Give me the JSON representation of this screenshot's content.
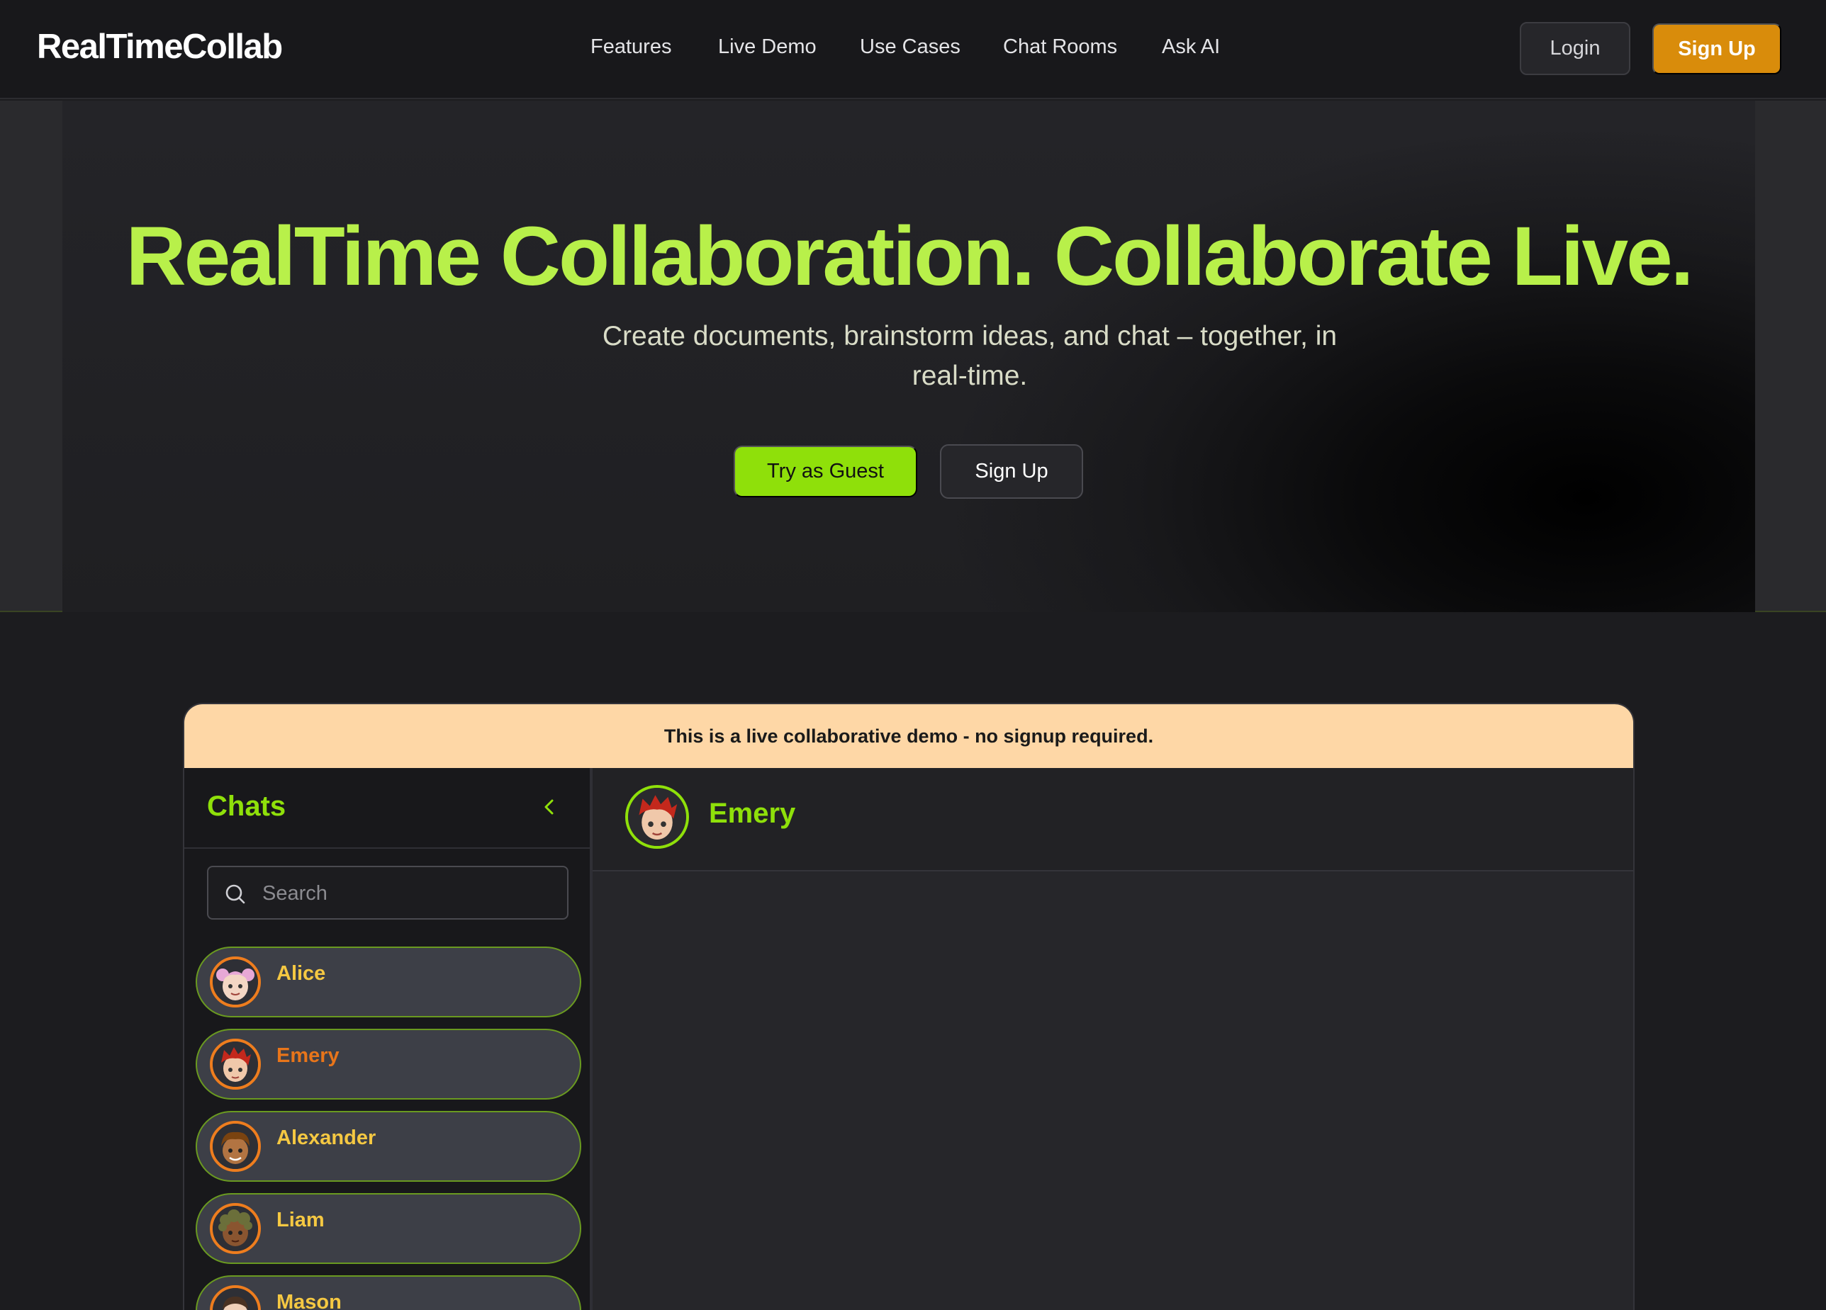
{
  "brand": {
    "name": "RealTimeCollab"
  },
  "nav": {
    "items": [
      "Features",
      "Live Demo",
      "Use Cases",
      "Chat Rooms",
      "Ask AI"
    ],
    "login": "Login",
    "signup": "Sign Up"
  },
  "hero": {
    "title": "RealTime Collaboration. Collaborate Live.",
    "subtitle_line1": "Create documents, brainstorm ideas, and chat – together, in",
    "subtitle_line2": "real-time.",
    "guest_button": "Try as Guest",
    "signup_button": "Sign Up"
  },
  "demo": {
    "banner": "This is a live collaborative demo - no signup required.",
    "sidebar": {
      "title": "Chats",
      "search_placeholder": "Search",
      "chats": [
        {
          "name": "Alice",
          "avatar": "alice-avatar",
          "active": false
        },
        {
          "name": "Emery",
          "avatar": "emery-avatar",
          "active": true
        },
        {
          "name": "Alexander",
          "avatar": "alexander-avatar",
          "active": false
        },
        {
          "name": "Liam",
          "avatar": "liam-avatar",
          "active": false
        },
        {
          "name": "Mason",
          "avatar": "mason-avatar",
          "active": false
        }
      ]
    },
    "active_chat": {
      "name": "Emery",
      "avatar": "emery-avatar"
    }
  },
  "colors": {
    "accent_green": "#8fe00a",
    "hero_title": "#b8f04a",
    "accent_orange": "#d98c0b",
    "banner": "#fed7a6",
    "chat_name": "#f5c842",
    "chat_name_active": "#e8751a"
  }
}
